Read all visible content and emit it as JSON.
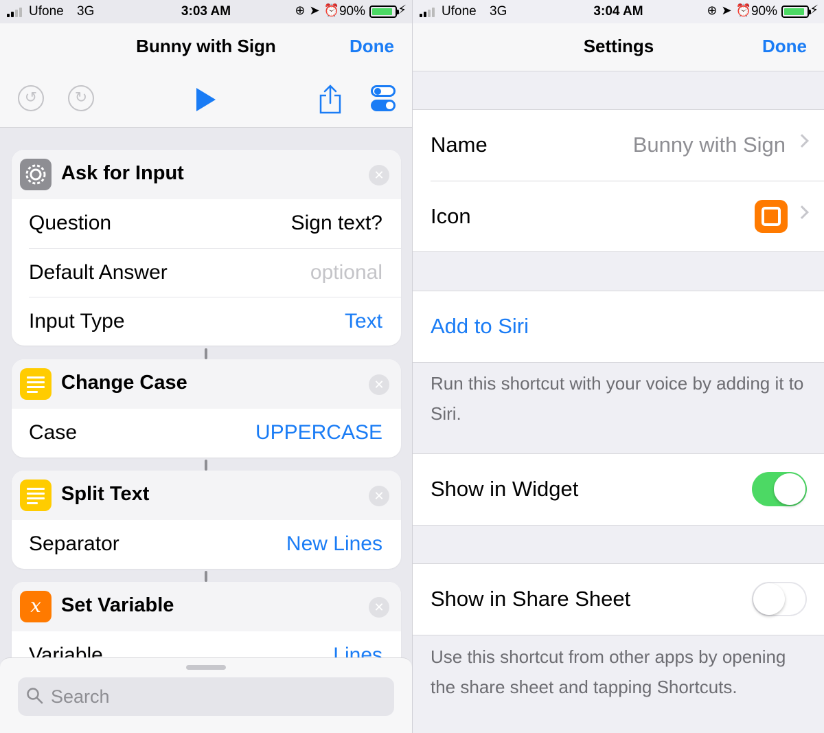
{
  "left": {
    "status": {
      "carrier": "Ufone",
      "network": "3G",
      "time": "3:03 AM",
      "battery": "90%",
      "battery_level": 0.9
    },
    "nav": {
      "title": "Bunny with Sign",
      "done": "Done"
    },
    "actions": [
      {
        "title": "Ask for Input",
        "icon": "gear-icon",
        "rows": [
          {
            "label": "Question",
            "value": "Sign text?"
          },
          {
            "label": "Default Answer",
            "value": "optional"
          },
          {
            "label": "Input Type",
            "value": "Text"
          }
        ]
      },
      {
        "title": "Change Case",
        "icon": "text-icon",
        "rows": [
          {
            "label": "Case",
            "value": "UPPERCASE"
          }
        ]
      },
      {
        "title": "Split Text",
        "icon": "text-icon",
        "rows": [
          {
            "label": "Separator",
            "value": "New Lines"
          }
        ]
      },
      {
        "title": "Set Variable",
        "icon": "variable-icon",
        "glyph": "x",
        "rows": [
          {
            "label": "Variable",
            "value": "Lines"
          }
        ]
      }
    ],
    "search": {
      "placeholder": "Search"
    }
  },
  "right": {
    "status": {
      "carrier": "Ufone",
      "network": "3G",
      "time": "3:04 AM",
      "battery": "90%",
      "battery_level": 0.9
    },
    "nav": {
      "title": "Settings",
      "done": "Done"
    },
    "name": {
      "label": "Name",
      "value": "Bunny with Sign"
    },
    "icon": {
      "label": "Icon"
    },
    "siri": {
      "label": "Add to Siri",
      "footer": "Run this shortcut with your voice by adding it to Siri."
    },
    "widget": {
      "label": "Show in Widget",
      "on": true
    },
    "share_sheet": {
      "label": "Show in Share Sheet",
      "on": false,
      "footer": "Use this shortcut from other apps by opening the share sheet and tapping Shortcuts."
    }
  },
  "colors": {
    "accent": "#1a7cf5",
    "switch_on": "#4cd964",
    "variable_icon": "#ff7a00",
    "text_icon": "#ffcc00"
  }
}
